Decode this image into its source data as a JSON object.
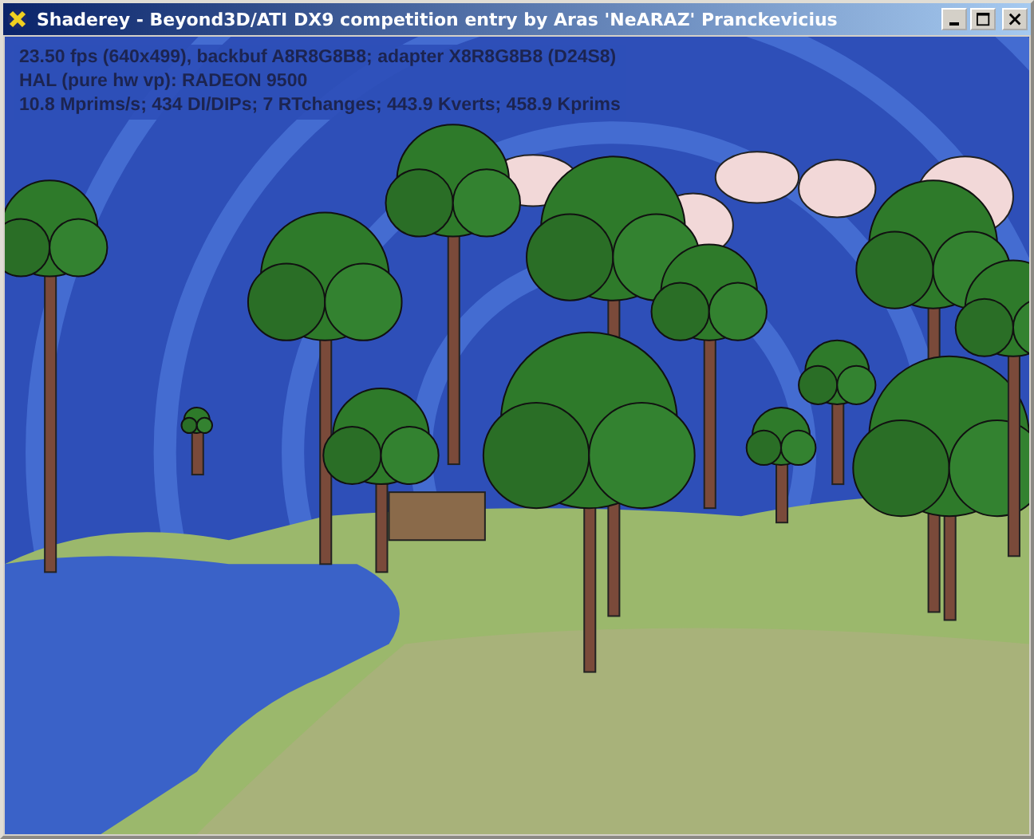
{
  "window": {
    "title": "Shaderey - Beyond3D/ATI DX9 competition entry by Aras 'NeARAZ' Pranckevicius"
  },
  "stats": [
    "23.50 fps (640x499), backbuf A8R8G8B8; adapter X8R8G8B8 (D24S8)",
    "HAL (pure hw vp): RADEON 9500",
    "10.8 Mprims/s;  434 DI/DIPs;  7 RTchanges;  443.9 Kverts;  458.9 Kprims"
  ]
}
